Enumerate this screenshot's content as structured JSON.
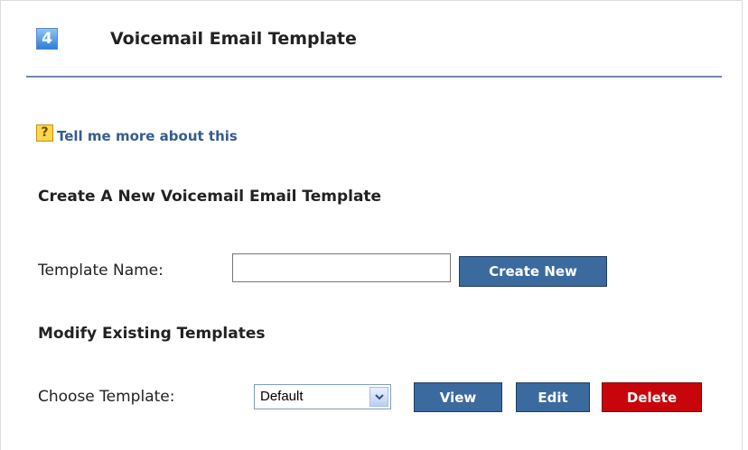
{
  "header": {
    "step_number": "4",
    "title": "Voicemail Email Template"
  },
  "help": {
    "icon_glyph": "?",
    "link_text": "Tell me more about this"
  },
  "create_section": {
    "title": "Create A New Voicemail Email Template",
    "name_label": "Template Name:",
    "name_value": "",
    "create_button_label": "Create New"
  },
  "modify_section": {
    "title": "Modify Existing Templates",
    "choose_label": "Choose Template:",
    "selected_template": "Default",
    "view_button_label": "View",
    "edit_button_label": "Edit",
    "delete_button_label": "Delete"
  },
  "colors": {
    "link": "#355c8f",
    "button_blue": "#3b6a9f",
    "button_red": "#c8050a",
    "header_rule": "#6f87ac"
  },
  "icons": {
    "step": "step-number-icon",
    "help": "help-icon",
    "dropdown": "chevron-down-icon"
  }
}
